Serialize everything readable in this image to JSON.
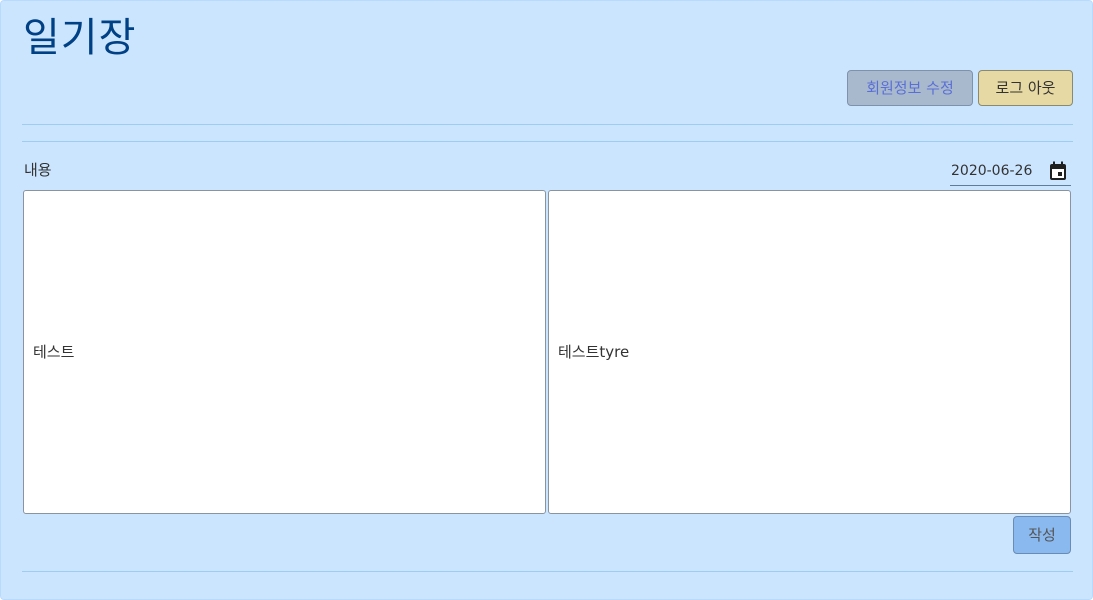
{
  "header": {
    "title": "일기장",
    "edit_profile_label": "회원정보 수정",
    "logout_label": "로그 아웃"
  },
  "form": {
    "content_label": "내용",
    "date_value": "2020-06-26",
    "left_text": "테스트",
    "right_text": "테스트tyre",
    "submit_label": "작성"
  },
  "colors": {
    "panel_bg": "#cce5ff",
    "title": "#004085",
    "edit_button_bg": "#a9b9cd",
    "logout_button_bg": "#e6d9a3",
    "submit_button_bg": "#8ab9f0"
  },
  "icons": {
    "date_picker": "calendar-icon"
  }
}
